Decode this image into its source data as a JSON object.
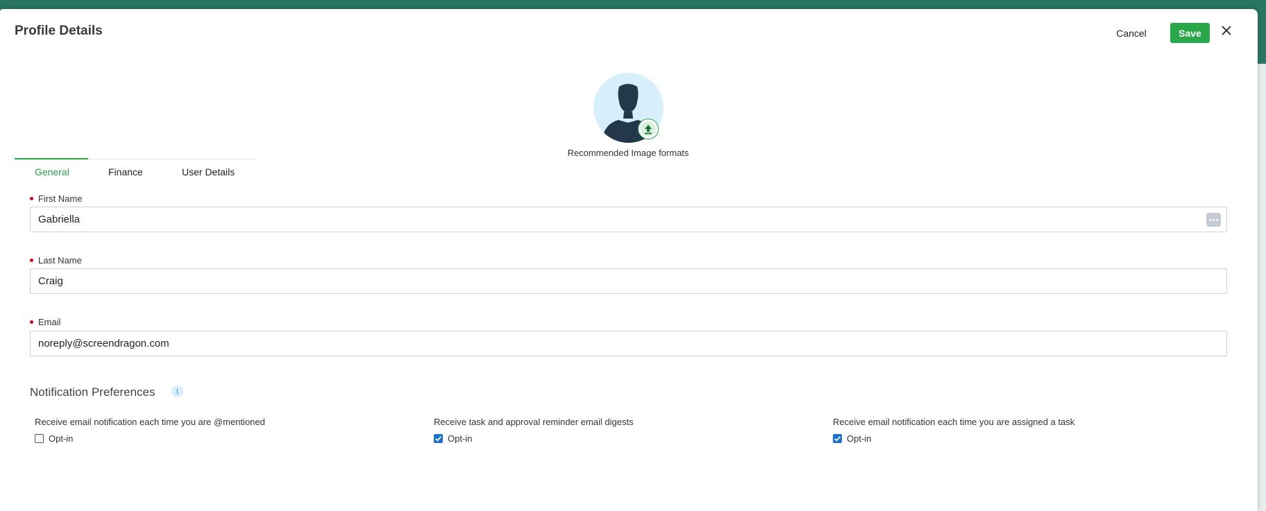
{
  "modal": {
    "title": "Profile Details",
    "cancel_label": "Cancel",
    "save_label": "Save"
  },
  "avatar": {
    "recommended_formats": "Recommended Image formats"
  },
  "tabs": [
    {
      "label": "General",
      "active": true
    },
    {
      "label": "Finance",
      "active": false
    },
    {
      "label": "User Details",
      "active": false
    }
  ],
  "fields": {
    "first_name": {
      "label": "First Name",
      "value": "Gabriella"
    },
    "last_name": {
      "label": "Last Name",
      "value": "Craig"
    },
    "email": {
      "label": "Email",
      "value": "noreply@screendragon.com"
    }
  },
  "notifications": {
    "title": "Notification Preferences",
    "info_glyph": "i",
    "items": [
      {
        "title": "Receive email notification each time you are @mentioned",
        "option": "Opt-in",
        "checked": false
      },
      {
        "title": "Receive task and approval reminder email digests",
        "option": "Opt-in",
        "checked": true
      },
      {
        "title": "Receive email notification each time you are assigned a task",
        "option": "Opt-in",
        "checked": true
      }
    ]
  },
  "colors": {
    "accent": "#2aa748",
    "checkbox_checked": "#1f73c7",
    "required": "#d0021b",
    "header_bg": "#2a7562"
  }
}
